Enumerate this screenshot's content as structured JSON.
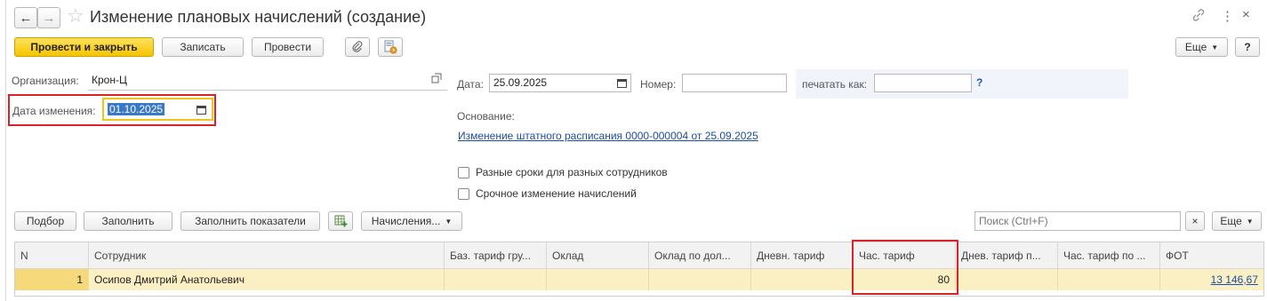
{
  "window": {
    "title": "Изменение плановых начислений (создание)",
    "nav_back": "←",
    "nav_forward": "→",
    "star": "☆",
    "link_icon": "🔗",
    "more_icon": "⋮",
    "close_icon": "×"
  },
  "toolbar": {
    "post_close_label": "Провести и закрыть",
    "save_label": "Записать",
    "post_label": "Провести",
    "more_label": "Еще",
    "help_label": "?"
  },
  "form": {
    "org_label": "Организация:",
    "org_value": "Крон-Ц",
    "date_label": "Дата:",
    "date_value": "25.09.2025",
    "number_label": "Номер:",
    "number_value": "",
    "print_as_label": "печатать как:",
    "print_as_value": "",
    "print_help": "?",
    "change_date_label": "Дата изменения:",
    "change_date_value": "01.10.2025",
    "basis_label": "Основание:",
    "basis_link": "Изменение штатного расписания 0000-000004 от 25.09.2025",
    "checkbox_different_terms": "Разные сроки для разных сотрудников",
    "checkbox_urgent": "Срочное изменение начислений"
  },
  "table_toolbar": {
    "select_label": "Подбор",
    "fill_label": "Заполнить",
    "fill_indicators_label": "Заполнить показатели",
    "accruals_label": "Начисления...",
    "search_placeholder": "Поиск (Ctrl+F)",
    "clear_label": "×",
    "more_label": "Еще"
  },
  "table": {
    "columns": [
      "N",
      "Сотрудник",
      "Баз. тариф гру...",
      "Оклад",
      "Оклад по дол...",
      "Дневн. тариф",
      "Час. тариф",
      "Днев. тариф п...",
      "Час. тариф по ...",
      "ФОТ"
    ],
    "rows": [
      {
        "n": "1",
        "employee": "Осипов Дмитрий Анатольевич",
        "base_rate": "",
        "salary": "",
        "position_salary": "",
        "daily_rate": "",
        "hourly_rate": "80",
        "daily_rate_p": "",
        "hourly_rate_p": "",
        "fot": "13 146,67"
      }
    ]
  }
}
